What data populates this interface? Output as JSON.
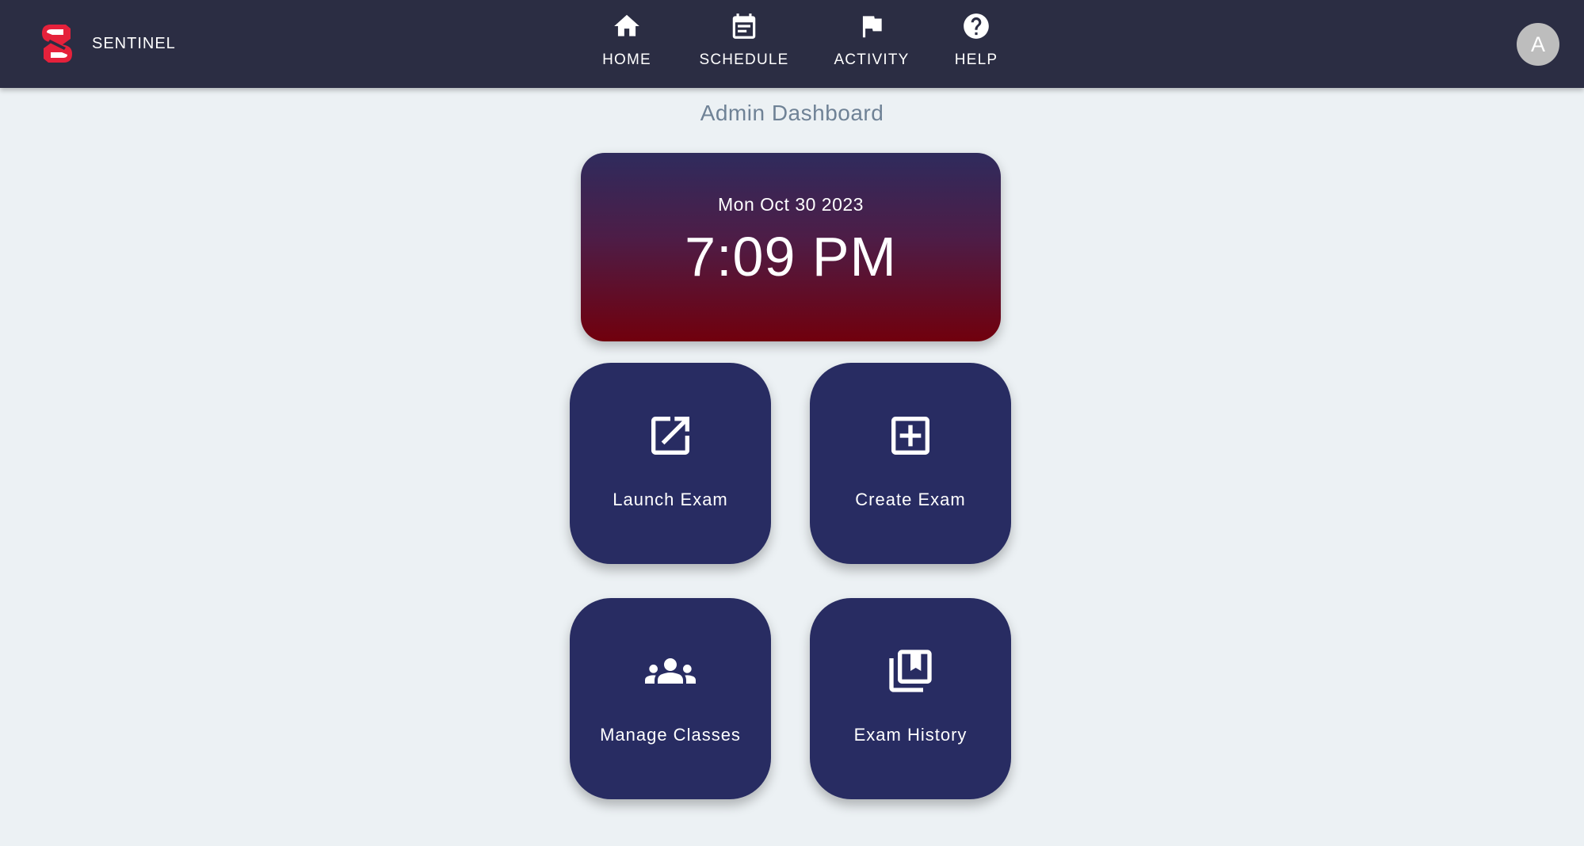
{
  "header": {
    "brand_name": "SENTINEL",
    "logo_icon": "sentinel-s-logo",
    "nav": [
      {
        "label": "HOME",
        "icon": "home-icon"
      },
      {
        "label": "SCHEDULE",
        "icon": "calendar-icon"
      },
      {
        "label": "ACTIVITY",
        "icon": "flag-icon"
      },
      {
        "label": "HELP",
        "icon": "help-circle-icon"
      }
    ],
    "avatar_initial": "A"
  },
  "main": {
    "title": "Admin Dashboard",
    "clock": {
      "date": "Mon Oct 30 2023",
      "time": "7:09 PM"
    },
    "tiles": [
      {
        "label": "Launch Exam",
        "icon": "external-link-icon"
      },
      {
        "label": "Create Exam",
        "icon": "add-box-icon"
      },
      {
        "label": "Manage Classes",
        "icon": "groups-icon"
      },
      {
        "label": "Exam History",
        "icon": "library-books-icon"
      }
    ]
  },
  "colors": {
    "header_bg": "#2b2d43",
    "page_bg": "#ecf1f4",
    "tile_bg": "#282c62",
    "clock_gradient_top": "#2f2b5d",
    "clock_gradient_bottom": "#71000d",
    "logo_red": "#e5213b",
    "avatar_bg": "#bdbdbd"
  }
}
